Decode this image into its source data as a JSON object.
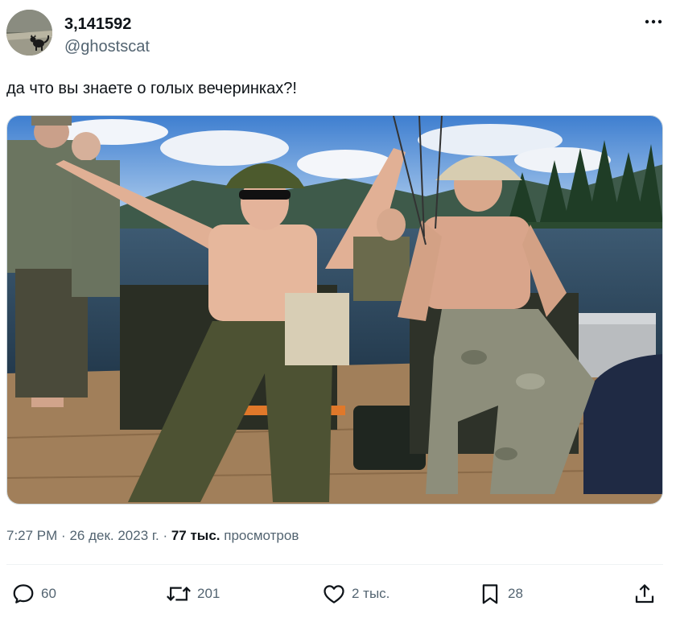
{
  "author": {
    "display_name": "3,141592",
    "handle": "@ghostscat"
  },
  "post": {
    "text": "да что вы знаете о голых вечеринках?!",
    "time": "7:27 PM",
    "date": "26 дек. 2023 г.",
    "views_count": "77 тыс.",
    "views_label": "просмотров"
  },
  "actions": {
    "reply_count": "60",
    "repost_count": "201",
    "like_count": "2 тыс.",
    "bookmark_count": "28"
  },
  "icons": {
    "more": "more-horizontal-icon",
    "reply": "reply-icon",
    "repost": "repost-icon",
    "like": "heart-icon",
    "bookmark": "bookmark-icon",
    "share": "share-icon"
  },
  "colors": {
    "text_primary": "#0f1419",
    "text_secondary": "#536471",
    "divider": "#eff3f4"
  }
}
